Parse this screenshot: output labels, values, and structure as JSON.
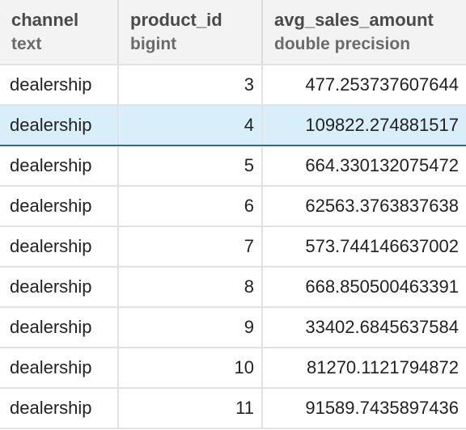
{
  "columns": [
    {
      "name": "channel",
      "type": "text"
    },
    {
      "name": "product_id",
      "type": "bigint"
    },
    {
      "name": "avg_sales_amount",
      "type": "double precision"
    }
  ],
  "rows": [
    {
      "channel": "dealership",
      "product_id": "3",
      "avg_sales_amount": "477.253737607644"
    },
    {
      "channel": "dealership",
      "product_id": "4",
      "avg_sales_amount": "109822.274881517"
    },
    {
      "channel": "dealership",
      "product_id": "5",
      "avg_sales_amount": "664.330132075472"
    },
    {
      "channel": "dealership",
      "product_id": "6",
      "avg_sales_amount": "62563.3763837638"
    },
    {
      "channel": "dealership",
      "product_id": "7",
      "avg_sales_amount": "573.744146637002"
    },
    {
      "channel": "dealership",
      "product_id": "8",
      "avg_sales_amount": "668.850500463391"
    },
    {
      "channel": "dealership",
      "product_id": "9",
      "avg_sales_amount": "33402.6845637584"
    },
    {
      "channel": "dealership",
      "product_id": "10",
      "avg_sales_amount": "81270.1121794872"
    },
    {
      "channel": "dealership",
      "product_id": "11",
      "avg_sales_amount": "91589.7435897436"
    }
  ],
  "selected_row": 1,
  "colors": {
    "header_bg": "#f3f3f3",
    "selected_bg": "#d8eef9",
    "selected_border": "#2a6e96",
    "grid_line": "#e2e2e2"
  }
}
